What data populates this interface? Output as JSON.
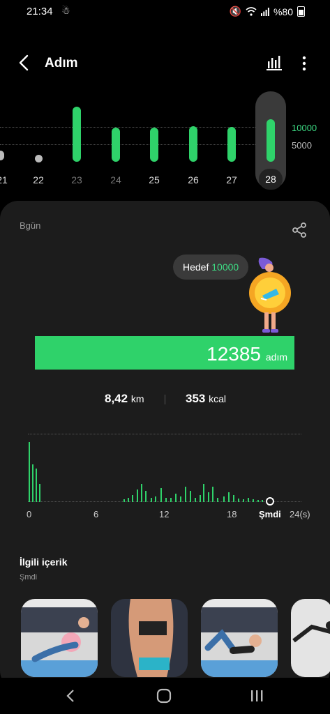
{
  "status": {
    "time": "21:34",
    "battery": "%80"
  },
  "header": {
    "title": "Adım"
  },
  "week_chart": {
    "scale": [
      "10000",
      "5000"
    ],
    "days": [
      "21",
      "22",
      "23",
      "24",
      "25",
      "26",
      "27",
      "28"
    ],
    "selected_day": "28"
  },
  "card": {
    "label": "Bgün",
    "goal_label": "Hedef",
    "goal_value": "10000",
    "steps": "12385",
    "steps_unit": "adım",
    "distance_value": "8,42",
    "distance_unit": "km",
    "calories_value": "353",
    "calories_unit": "kcal"
  },
  "hourly": {
    "ticks": [
      "0",
      "6",
      "12",
      "18"
    ],
    "now_label": "Şmdi",
    "end_label": "24(s)"
  },
  "related": {
    "title": "İlgili içerik",
    "subtitle": "Şmdi"
  },
  "colors": {
    "accent": "#2fd26a",
    "card": "#1c1c1c",
    "background": "#000000"
  },
  "icons": [
    "back-arrow-icon",
    "bar-chart-icon",
    "more-vert-icon",
    "share-icon",
    "sound-off-icon",
    "wifi-icon",
    "signal-icon",
    "battery-icon"
  ]
}
